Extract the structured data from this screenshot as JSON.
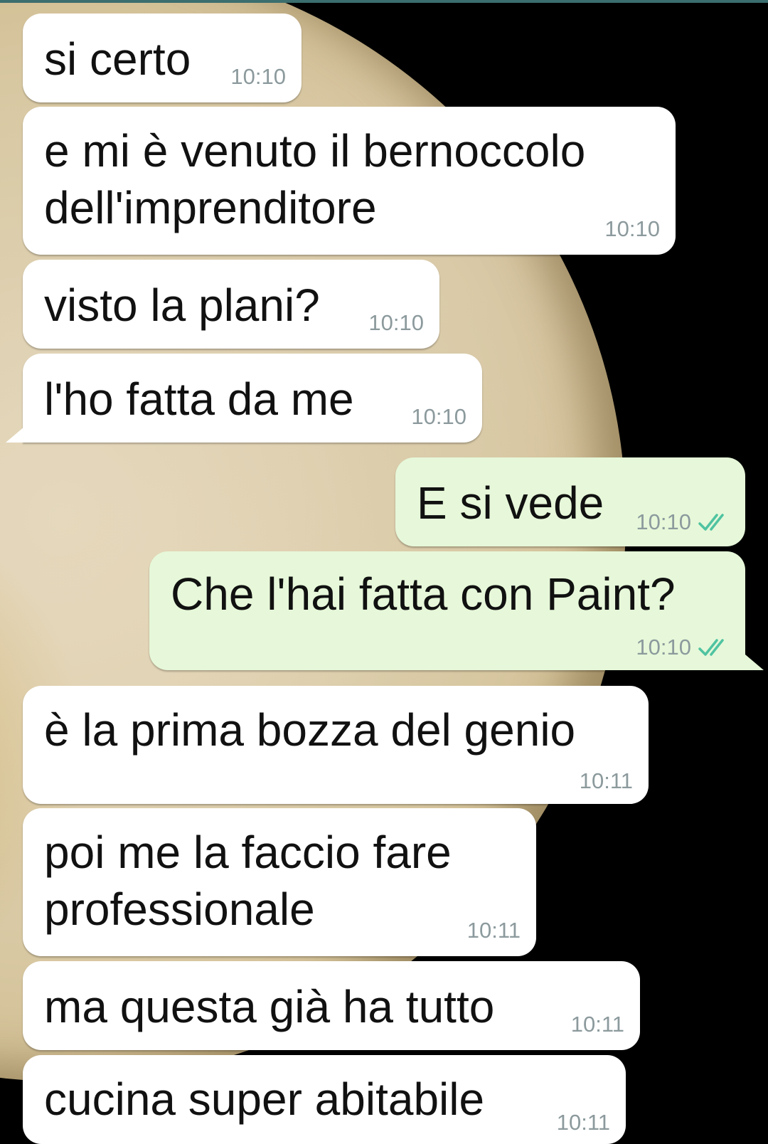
{
  "conversation": {
    "messages": [
      {
        "direction": "incoming",
        "text": "si certo",
        "time": "10:10"
      },
      {
        "direction": "incoming",
        "lines": [
          "e mi è venuto il bernoccolo",
          "dell'imprenditore"
        ],
        "time": "10:10"
      },
      {
        "direction": "incoming",
        "text": "visto la plani?",
        "time": "10:10"
      },
      {
        "direction": "incoming",
        "text": "l'ho fatta da me",
        "time": "10:10"
      },
      {
        "direction": "outgoing",
        "text": "E si vede",
        "time": "10:10",
        "status": "read"
      },
      {
        "direction": "outgoing",
        "text": "Che l'hai fatta con Paint?",
        "time": "10:10",
        "status": "read"
      },
      {
        "direction": "incoming",
        "text": "è la prima bozza del genio",
        "time": "10:11"
      },
      {
        "direction": "incoming",
        "lines": [
          "poi me la faccio fare",
          "professionale"
        ],
        "time": "10:11"
      },
      {
        "direction": "incoming",
        "text": "ma questa già ha tutto",
        "time": "10:11"
      },
      {
        "direction": "incoming",
        "text": "cucina super abitabile",
        "time": "10:11"
      }
    ]
  },
  "colors": {
    "incoming_bubble": "#ffffff",
    "outgoing_bubble": "#e6f8d9",
    "read_ticks": "#4fc3a1",
    "timestamp": "#8c9a9d"
  },
  "icons": {
    "read_status": "double-check-icon"
  }
}
